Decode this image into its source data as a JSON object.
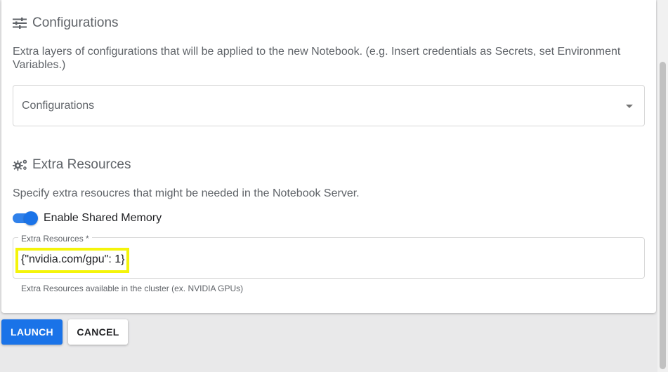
{
  "configurations": {
    "title": "Configurations",
    "description": "Extra layers of configurations that will be applied to the new Notebook. (e.g. Insert credentials as Secrets, set Environment Variables.)",
    "select_placeholder": "Configurations",
    "icon": "tune-sliders-icon"
  },
  "extra_resources": {
    "title": "Extra Resources",
    "description": "Specify extra resoucres that might be needed in the Notebook Server.",
    "icon": "gears-icon",
    "shared_memory_label": "Enable Shared Memory",
    "shared_memory_enabled": true,
    "field_label": "Extra Resources *",
    "field_value": "{\"nvidia.com/gpu\": 1}",
    "field_hint": "Extra Resources available in the cluster (ex. NVIDIA GPUs)"
  },
  "actions": {
    "launch_label": "LAUNCH",
    "cancel_label": "CANCEL"
  },
  "colors": {
    "primary": "#1a73e8",
    "highlight": "#f4f40a"
  }
}
